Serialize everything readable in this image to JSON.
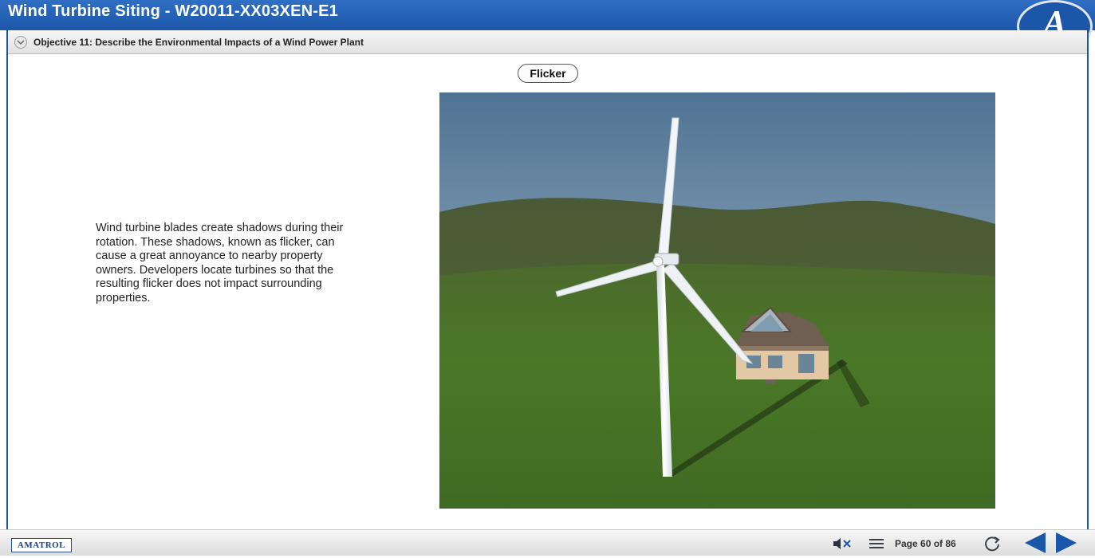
{
  "header": {
    "title": "Wind Turbine Siting - W20011-XX03XEN-E1",
    "logo_letter": "A",
    "color": "#1c56a8"
  },
  "objective": {
    "text": "Objective 11: Describe the Environmental Impacts of a Wind Power Plant",
    "toggle_icon": "chevron-down-icon"
  },
  "content": {
    "flicker_button": "Flicker",
    "description": "Wind turbine blades create shadows during their rotation. These shadows, known as flicker, can cause a great annoyance to nearby property owners. Developers locate turbines so that the resulting flicker does not impact surrounding properties.",
    "illustration": "wind-turbine-house-scene"
  },
  "footer": {
    "brand": "AMATROL",
    "page_text": "Page 60 of 86",
    "icons": [
      "mute-icon",
      "menu-icon",
      "refresh-icon",
      "back-arrow-icon",
      "forward-arrow-icon"
    ],
    "arrow_color": "#1c56a8"
  }
}
